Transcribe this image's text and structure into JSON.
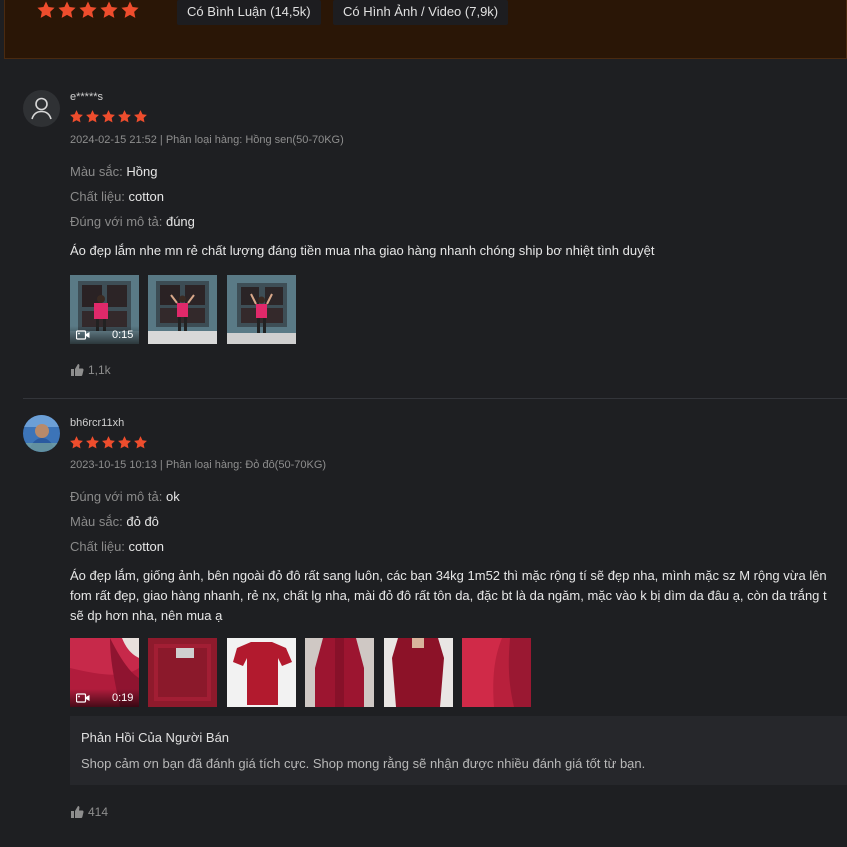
{
  "filter_bar": {
    "rating_stars": 5,
    "buttons": [
      {
        "label": "Có Bình Luận (14,5k)"
      },
      {
        "label": "Có Hình Ảnh / Video (7,9k)"
      }
    ]
  },
  "colors": {
    "star": "#ee4d2d",
    "accent_bg": "#2a1606"
  },
  "reviews": [
    {
      "username": "e*****s",
      "rating": 5,
      "meta": "2024-02-15 21:52 | Phân loại hàng: Hồng sen(50-70KG)",
      "attributes": [
        {
          "key": "Màu sắc:",
          "value": "Hồng"
        },
        {
          "key": "Chất liệu:",
          "value": "cotton"
        },
        {
          "key": "Đúng với mô tả:",
          "value": "đúng"
        }
      ],
      "content_lines": [
        "Áo đẹp lắm nhe mn rẻ chất lượng đáng tiền mua nha giao hàng nhanh chóng ship bơ nhiệt tình duyệt"
      ],
      "video_duration": "0:15",
      "likes": "1,1k"
    },
    {
      "username": "bh6rcr11xh",
      "rating": 5,
      "meta": "2023-10-15 10:13 | Phân loại hàng: Đỏ đô(50-70KG)",
      "attributes": [
        {
          "key": "Đúng với mô tả:",
          "value": "ok"
        },
        {
          "key": "Màu sắc:",
          "value": "đỏ đô"
        },
        {
          "key": "Chất liệu:",
          "value": "cotton"
        }
      ],
      "content_lines": [
        "Áo đẹp lắm, giống ảnh, bên ngoài đỏ đô rất sang luôn, các bạn 34kg 1m52 thì mặc rộng tí sẽ đẹp nha, mình mặc sz M rộng vừa lên",
        "fom rất đẹp, giao hàng nhanh, rẻ nx, chất lg nha, mài đỏ đô rất tôn da, đặc bt là da ngăm, mặc vào k bị dìm da đâu ạ, còn da trắng t",
        "sẽ dp hơn nha, nên mua ạ"
      ],
      "video_duration": "0:19",
      "seller_reply": {
        "title": "Phản Hồi Của Người Bán",
        "text": "Shop cảm ơn bạn đã đánh giá tích cực. Shop mong rằng sẽ nhận được nhiều đánh giá tốt từ bạn."
      },
      "likes": "414"
    }
  ]
}
